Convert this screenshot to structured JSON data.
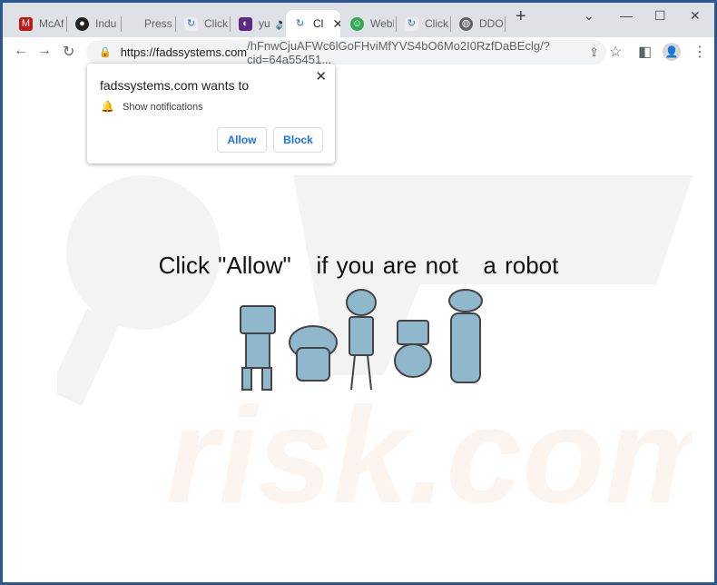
{
  "tabs": [
    {
      "label": "McAfee",
      "icon": "mcafee-icon",
      "color": "#c01818"
    },
    {
      "label": "Indu (",
      "icon": "film-reel-icon",
      "color": "#222"
    },
    {
      "label": "Press",
      "icon": "",
      "color": ""
    },
    {
      "label": "Click",
      "icon": "edge-refresh-icon",
      "color": "#2b6fd6"
    },
    {
      "label": "yu",
      "icon": "app-icon",
      "color": "#5b2a86"
    },
    {
      "label": "Cl",
      "icon": "edge-refresh-icon",
      "color": "#2b6fd6",
      "active": true
    },
    {
      "label": "WebD",
      "icon": "green-smiley-icon",
      "color": "#34a853"
    },
    {
      "label": "Click",
      "icon": "edge-refresh-icon",
      "color": "#2b6fd6"
    },
    {
      "label": "DDOS",
      "icon": "globe-icon",
      "color": "#5f6368"
    }
  ],
  "address": {
    "domain": "https://fadssystems.com",
    "path": "/hFnwCjuAFWc6lGoFHviMfYVS4bO6Mo2I0RzfDaBEclg/?cid=64a55451..."
  },
  "popup": {
    "title": "fadssystems.com wants to",
    "permission": "Show notifications",
    "allow": "Allow",
    "block": "Block"
  },
  "page": {
    "headline": "Click \"Allow\"   if you are not   a robot",
    "watermark": "risk.com"
  },
  "colors": {
    "accent": "#1a73e8",
    "frame": "#2b5797",
    "robot": "#8fb8cc"
  }
}
